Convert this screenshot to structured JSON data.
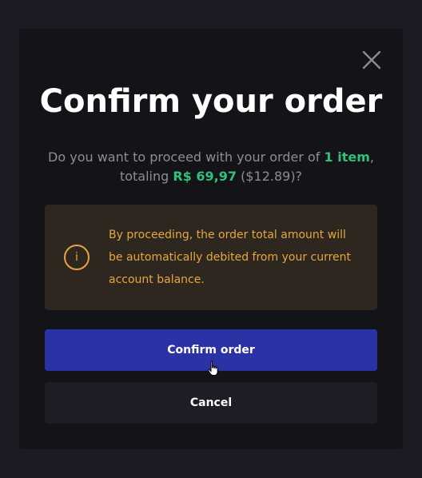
{
  "modal": {
    "title": "Confirm your order",
    "description": {
      "prefix": "Do you want to proceed with your order of ",
      "item_count": "1 item",
      "middle": ", totaling ",
      "total_brl": "R$ 69,97",
      "suffix": " ($12.89)?"
    },
    "notice": {
      "icon": "info-icon",
      "icon_glyph": "i",
      "text": "By proceeding, the order total amount will be automatically debited from your current account balance."
    },
    "buttons": {
      "confirm_label": "Confirm order",
      "cancel_label": "Cancel"
    },
    "close_icon": "close-icon"
  },
  "colors": {
    "accent_green": "#2ec27a",
    "warning_amber": "#e7a53f",
    "primary_button": "#2a32a5"
  }
}
